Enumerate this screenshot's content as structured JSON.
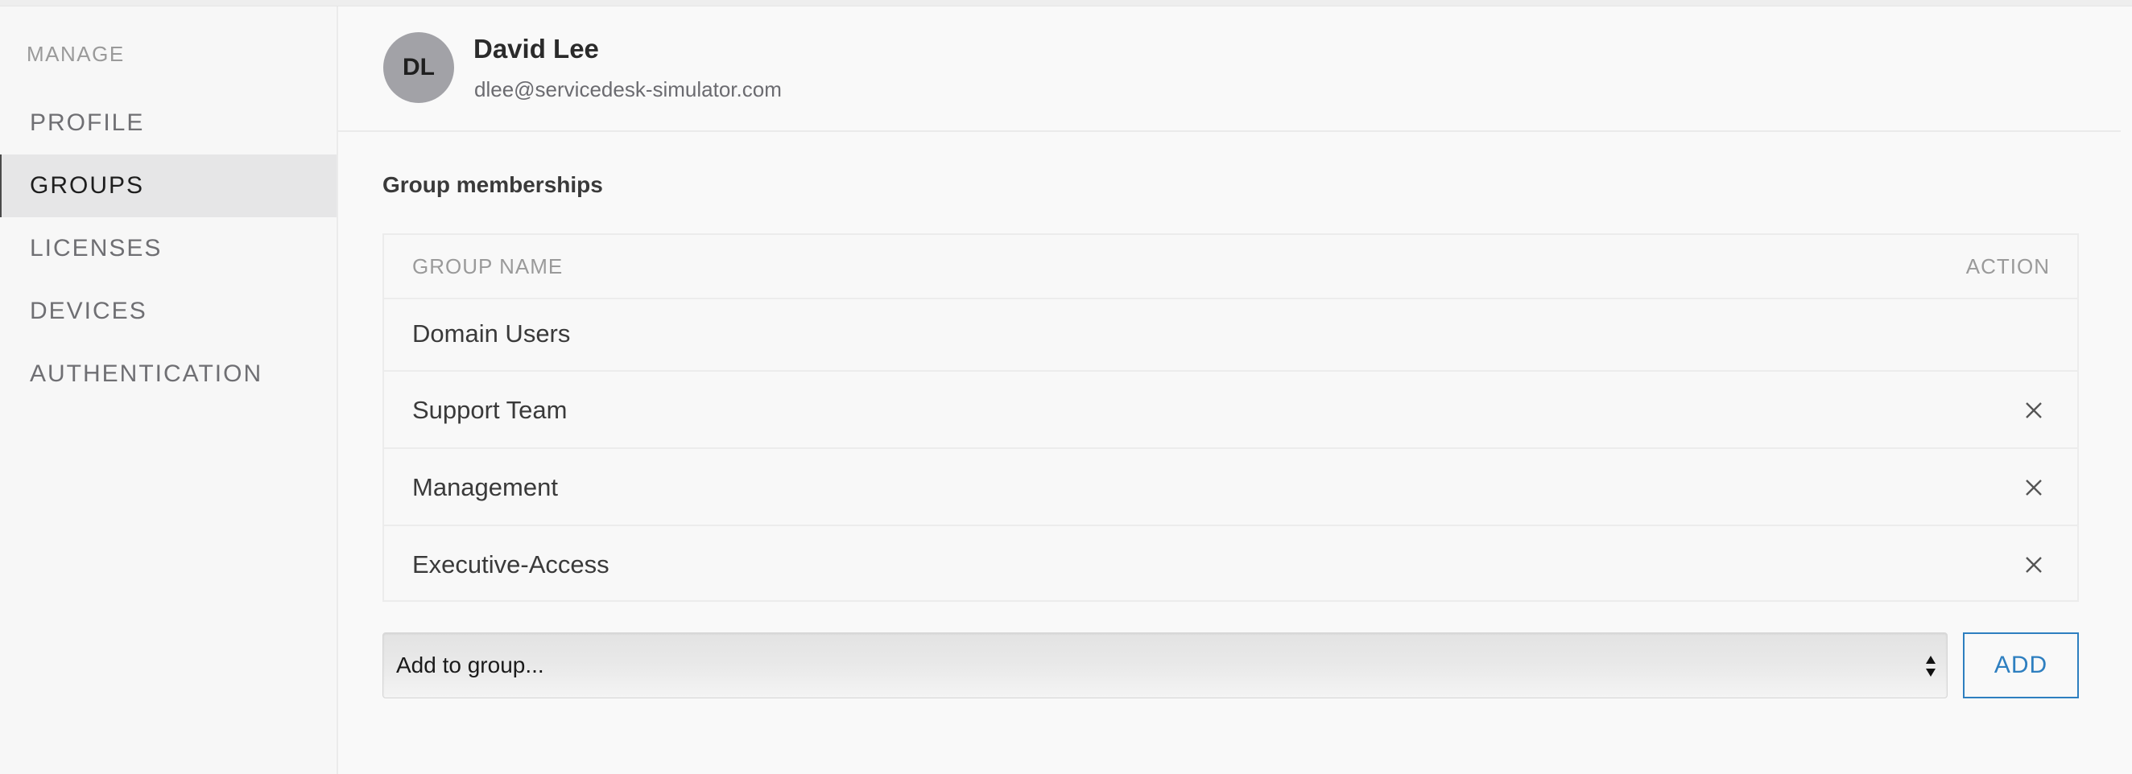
{
  "sidebar": {
    "heading": "MANAGE",
    "items": [
      {
        "label": "PROFILE",
        "active": false
      },
      {
        "label": "GROUPS",
        "active": true
      },
      {
        "label": "LICENSES",
        "active": false
      },
      {
        "label": "DEVICES",
        "active": false
      },
      {
        "label": "AUTHENTICATION",
        "active": false
      }
    ]
  },
  "user": {
    "initials": "DL",
    "name": "David Lee",
    "email": "dlee@servicedesk-simulator.com"
  },
  "groups": {
    "title": "Group memberships",
    "columns": {
      "name": "GROUP NAME",
      "action": "ACTION"
    },
    "rows": [
      {
        "name": "Domain Users",
        "removable": false,
        "action_icon": ""
      },
      {
        "name": "Support Team",
        "removable": true,
        "action_icon": "close-icon"
      },
      {
        "name": "Management",
        "removable": true,
        "action_icon": "close-icon"
      },
      {
        "name": "Executive-Access",
        "removable": true,
        "action_icon": "close-icon"
      }
    ],
    "add_select": {
      "selected": "Add to group..."
    },
    "add_label": "ADD"
  },
  "colors": {
    "accent": "#2e7fc0",
    "avatar_bg": "#a2a2a7",
    "active_nav_bg": "#e6e6e7"
  }
}
